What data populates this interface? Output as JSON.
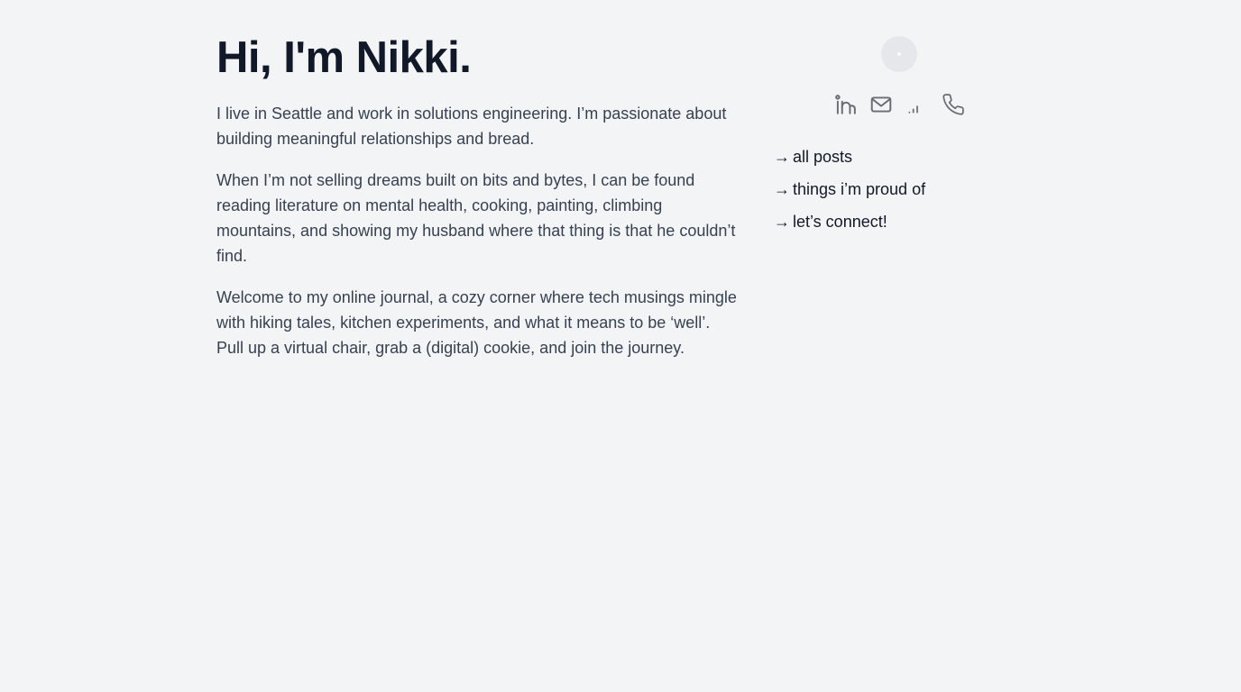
{
  "intro": {
    "title": "Hi, I'm Nikki.",
    "paragraphs": [
      "I live in Seattle and work in solutions engineering. I’m passionate about building meaningful relationships and bread.",
      "When I’m not selling dreams built on bits and bytes, I can be found reading literature on mental health, cooking, painting, climbing mountains, and showing my husband where that thing is that he couldn’t find.",
      "Welcome to my online journal, a cozy corner where tech musings mingle with hiking tales, kitchen experiments, and what it means to be ‘well’. Pull up a virtual chair, grab a (digital) cookie, and join the journey."
    ]
  },
  "sidebar": {
    "social_icons": [
      "linkedin-icon",
      "mail-icon",
      "signal-bars-icon",
      "phone-icon"
    ],
    "nav": [
      {
        "arrow": "→",
        "label": "all posts"
      },
      {
        "arrow": "→",
        "label": "things i’m proud of"
      },
      {
        "arrow": "→",
        "label": "let’s connect!"
      }
    ]
  },
  "colors": {
    "background": "#f3f4f6",
    "heading": "#111827",
    "body_text": "#374151",
    "icon": "#6b6b70",
    "avatar_placeholder": "#e5e7eb"
  }
}
